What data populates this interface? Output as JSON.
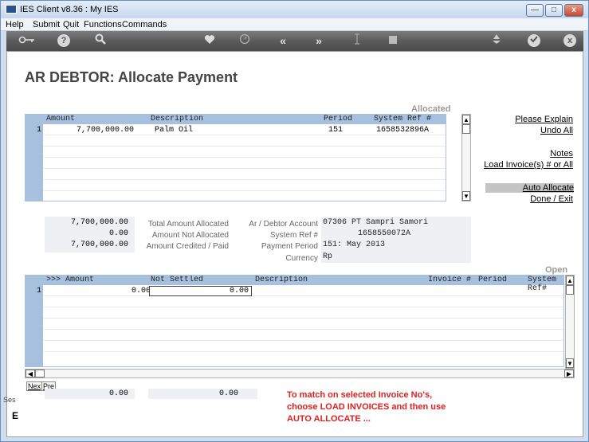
{
  "window": {
    "title": "IES Client v8.36 : My IES",
    "min_label": "—",
    "max_label": "□",
    "close_label": "x"
  },
  "menu": [
    "Help",
    "Submit",
    "Quit",
    "Functions",
    "Commands"
  ],
  "toolbar": {
    "help_label": "?",
    "back_label": "«",
    "forward_label": "»",
    "close_label": "x"
  },
  "page": {
    "title": "AR DEBTOR: Allocate Payment",
    "allocated_label": "Allocated",
    "open_label": "Open"
  },
  "allocated_grid": {
    "columns": [
      "Amount",
      "Description",
      "Period",
      "System Ref #"
    ],
    "rows": [
      {
        "num": "1",
        "amount": "7,700,000.00",
        "description": "Palm Oil",
        "period": "151",
        "sysref": "1658532896A"
      }
    ]
  },
  "actions": {
    "please_explain": "Please Explain",
    "undo_all": "Undo All",
    "notes": "Notes",
    "load_invoices": "Load Invoice(s) # or All",
    "auto_allocate": "Auto Allocate",
    "done_exit": "Done / Exit"
  },
  "totals": {
    "total_allocated": "7,700,000.00",
    "not_allocated": "0.00",
    "credited_paid": "7,700,000.00",
    "total_allocated_label": "Total Amount Allocated",
    "not_allocated_label": "Amount Not Allocated",
    "credited_paid_label": "Amount Credited / Paid"
  },
  "account_info": {
    "account_label": "Ar / Debtor Account",
    "account_value": "07306 PT Sampri Samori",
    "sysref_label": "System Ref #",
    "sysref_value": "1658550072A",
    "period_label": "Payment Period",
    "period_value": "151: May 2013",
    "currency_label": "Currency",
    "currency_value": "Rp"
  },
  "open_grid": {
    "columns": [
      ">>> Amount",
      "Not Settled",
      "Description",
      "Invoice #",
      "Period",
      "System Ref#"
    ],
    "rows": [
      {
        "num": "1",
        "amount": "0.00",
        "not_settled": "0.00"
      }
    ]
  },
  "tabs": {
    "next": "Nex",
    "prev": "Pre"
  },
  "footer_totals": {
    "amount": "0.00",
    "not_settled": "0.00"
  },
  "side_fragments": {
    "ses": "Ses",
    "e": "E"
  },
  "note": {
    "line1": "To match on selected Invoice No's,",
    "line2": "choose LOAD INVOICES and then use",
    "line3": "AUTO ALLOCATE ..."
  },
  "colors": {
    "grid_header": "#a7c0dd",
    "note_red": "#e02020",
    "toolbar_dark": "#5b5b5b"
  },
  "icons": [
    "key-icon",
    "help-icon",
    "search-icon",
    "heart-icon",
    "clock-icon",
    "back-icon",
    "forward-icon",
    "cursor-icon",
    "stop-icon",
    "recycle-icon",
    "check-icon",
    "close-icon"
  ]
}
